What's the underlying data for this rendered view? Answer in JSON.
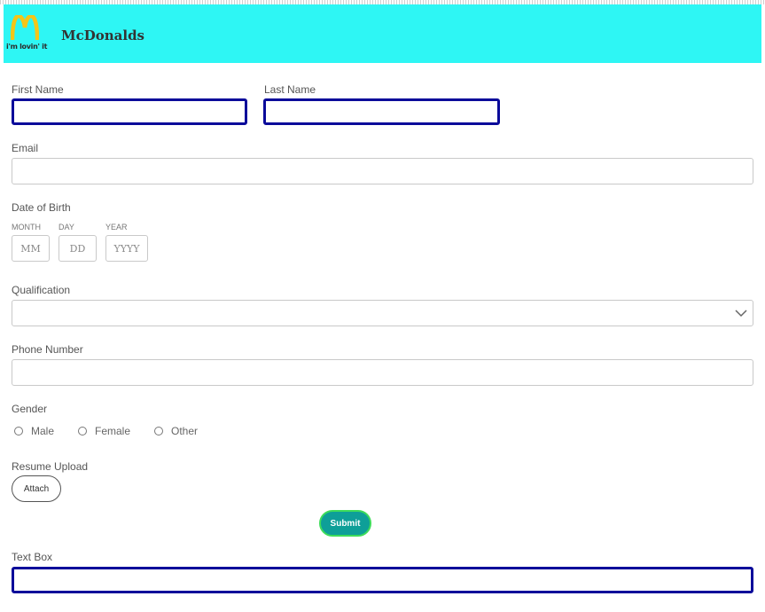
{
  "header": {
    "brand": "McDonalds",
    "logo_tagline": "i'm lovin' it",
    "background_color": "#2ef6f4",
    "logo_arches_color": "#f5c518"
  },
  "form": {
    "first_name": {
      "label": "First Name",
      "value": ""
    },
    "last_name": {
      "label": "Last Name",
      "value": ""
    },
    "email": {
      "label": "Email",
      "value": ""
    },
    "dob": {
      "label": "Date of Birth",
      "month_label": "MONTH",
      "month_placeholder": "MM",
      "day_label": "DAY",
      "day_placeholder": "DD",
      "year_label": "YEAR",
      "year_placeholder": "YYYY"
    },
    "qualification": {
      "label": "Qualification",
      "selected": ""
    },
    "phone": {
      "label": "Phone Number",
      "value": ""
    },
    "gender": {
      "label": "Gender",
      "options": [
        "Male",
        "Female",
        "Other"
      ]
    },
    "resume": {
      "label": "Resume Upload",
      "button": "Attach"
    },
    "submit_label": "Submit",
    "text_box": {
      "label": "Text Box",
      "value": ""
    }
  },
  "colors": {
    "focus_border": "#0b0b9a",
    "submit_bg": "#0e9f98",
    "submit_border": "#3ddc5a"
  }
}
